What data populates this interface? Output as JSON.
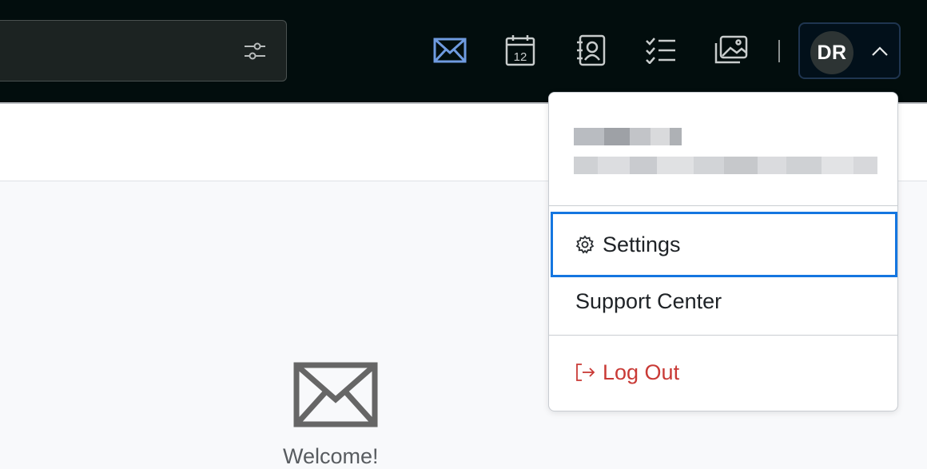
{
  "header": {
    "search": {
      "placeholder": "",
      "filter_icon": "sliders-icon"
    },
    "nav_icons": [
      {
        "name": "mail-icon",
        "active": true
      },
      {
        "name": "calendar-icon",
        "label": "12"
      },
      {
        "name": "contacts-icon"
      },
      {
        "name": "tasks-icon"
      },
      {
        "name": "photos-icon"
      }
    ],
    "account": {
      "initials": "DR",
      "chevron": "chevron-up-icon"
    }
  },
  "dropdown": {
    "user_name_obscured": true,
    "user_email_obscured": true,
    "items": [
      {
        "label": "Settings",
        "icon": "gear-icon",
        "focused": true
      },
      {
        "label": "Support Center"
      },
      {
        "label": "Log Out",
        "icon": "logout-icon",
        "danger": true
      }
    ]
  },
  "main": {
    "icon": "mail-icon",
    "welcome": "Welcome!"
  },
  "colors": {
    "topbar": "#020d0d",
    "active_icon": "#6f9be0",
    "icon": "#c8cccc",
    "focus_ring": "#1476e0",
    "danger": "#c93a36"
  }
}
